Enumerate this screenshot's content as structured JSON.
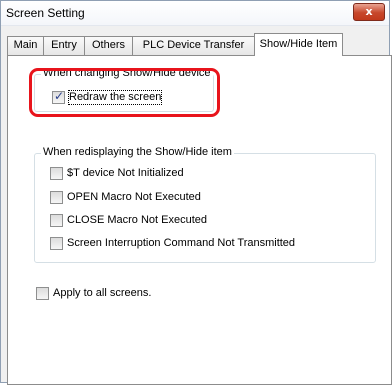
{
  "window": {
    "title": "Screen Setting",
    "close_glyph": "x"
  },
  "tabs": [
    {
      "label": "Main",
      "active": false
    },
    {
      "label": "Entry",
      "active": false
    },
    {
      "label": "Others",
      "active": false
    },
    {
      "label": "PLC Device Transfer",
      "active": false
    },
    {
      "label": "Show/Hide Item",
      "active": true
    }
  ],
  "group_show_hide": {
    "title": "When changing Show/Hide device",
    "redraw": {
      "label": "Redraw the screen",
      "checked": true
    }
  },
  "group_redisplay": {
    "title": "When redisplaying the Show/Hide item",
    "options": [
      {
        "label": "$T device Not Initialized",
        "checked": false
      },
      {
        "label": "OPEN Macro Not Executed",
        "checked": false
      },
      {
        "label": "CLOSE Macro Not Executed",
        "checked": false
      },
      {
        "label": "Screen Interruption Command Not Transmitted",
        "checked": false
      }
    ]
  },
  "apply_all": {
    "label": "Apply to all screens.",
    "checked": false
  },
  "colors": {
    "highlight": "#e8141c",
    "close_button": "#c7472b",
    "check_mark": "#2a3f8a"
  },
  "icons": {
    "close": "close-icon",
    "check": "check-icon"
  }
}
